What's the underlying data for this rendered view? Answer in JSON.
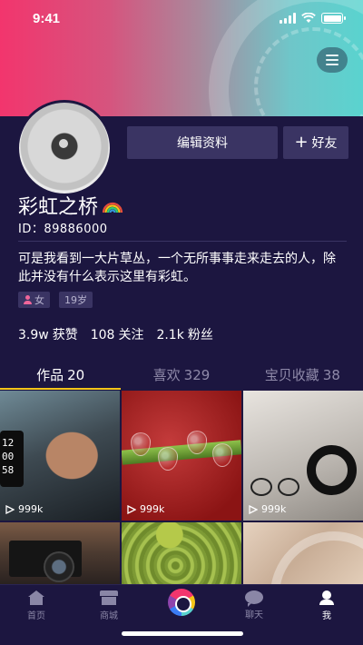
{
  "status_bar": {
    "time": "9:41"
  },
  "profile": {
    "edit_label": "编辑资料",
    "add_friend_label": "好友",
    "add_friend_plus": "+",
    "name": "彩虹之桥",
    "id_text": "ID：89886000",
    "bio": "可是我看到一大片草丛，一个无所事事走来走去的人，除此并没有什么表示这里有彩虹。",
    "tags": [
      {
        "label": "女",
        "icon": "female-icon"
      },
      {
        "label": "19岁"
      }
    ],
    "stats": [
      {
        "value": "3.9w",
        "label": "获赞"
      },
      {
        "value": "108",
        "label": "关注"
      },
      {
        "value": "2.1k",
        "label": "粉丝"
      }
    ]
  },
  "tabs": [
    {
      "label": "作品",
      "count": "20",
      "active": true
    },
    {
      "label": "喜欢",
      "count": "329",
      "active": false
    },
    {
      "label": "宝贝收藏",
      "count": "38",
      "active": false
    }
  ],
  "grid": [
    {
      "plays": "999k",
      "icon": "play-icon",
      "watch_text": "12\n00\n58"
    },
    {
      "plays": "999k",
      "icon": "play-icon"
    },
    {
      "plays": "999k",
      "icon": "play-icon"
    },
    {
      "plays": ""
    },
    {
      "plays": ""
    },
    {
      "plays": ""
    }
  ],
  "bottom_nav": [
    {
      "label": "首页",
      "icon": "home-icon"
    },
    {
      "label": "商城",
      "icon": "shop-icon"
    },
    {
      "label": "",
      "icon": "aperture-icon"
    },
    {
      "label": "聊天",
      "icon": "chat-icon"
    },
    {
      "label": "我",
      "icon": "me-icon",
      "active": true
    }
  ],
  "colors": {
    "background": "#1c1640",
    "button_bg": "#3a3463",
    "tab_indicator": "#f5c518",
    "banner_start": "#f2356d",
    "banner_end": "#5ad3cf"
  }
}
